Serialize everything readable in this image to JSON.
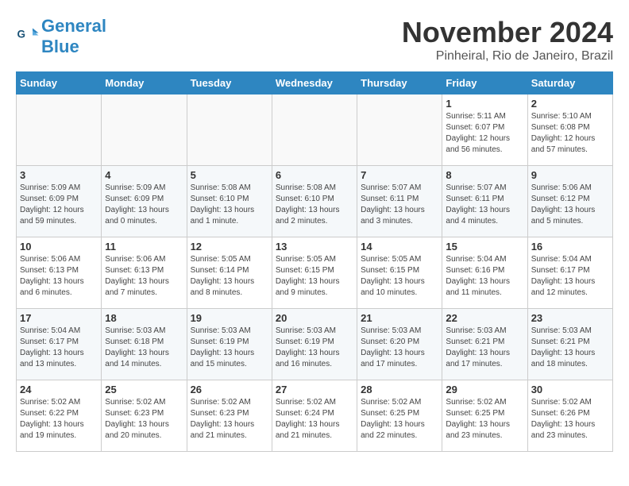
{
  "logo": {
    "line1": "General",
    "line2": "Blue"
  },
  "title": "November 2024",
  "location": "Pinheiral, Rio de Janeiro, Brazil",
  "headers": [
    "Sunday",
    "Monday",
    "Tuesday",
    "Wednesday",
    "Thursday",
    "Friday",
    "Saturday"
  ],
  "weeks": [
    [
      {
        "day": "",
        "info": ""
      },
      {
        "day": "",
        "info": ""
      },
      {
        "day": "",
        "info": ""
      },
      {
        "day": "",
        "info": ""
      },
      {
        "day": "",
        "info": ""
      },
      {
        "day": "1",
        "info": "Sunrise: 5:11 AM\nSunset: 6:07 PM\nDaylight: 12 hours\nand 56 minutes."
      },
      {
        "day": "2",
        "info": "Sunrise: 5:10 AM\nSunset: 6:08 PM\nDaylight: 12 hours\nand 57 minutes."
      }
    ],
    [
      {
        "day": "3",
        "info": "Sunrise: 5:09 AM\nSunset: 6:09 PM\nDaylight: 12 hours\nand 59 minutes."
      },
      {
        "day": "4",
        "info": "Sunrise: 5:09 AM\nSunset: 6:09 PM\nDaylight: 13 hours\nand 0 minutes."
      },
      {
        "day": "5",
        "info": "Sunrise: 5:08 AM\nSunset: 6:10 PM\nDaylight: 13 hours\nand 1 minute."
      },
      {
        "day": "6",
        "info": "Sunrise: 5:08 AM\nSunset: 6:10 PM\nDaylight: 13 hours\nand 2 minutes."
      },
      {
        "day": "7",
        "info": "Sunrise: 5:07 AM\nSunset: 6:11 PM\nDaylight: 13 hours\nand 3 minutes."
      },
      {
        "day": "8",
        "info": "Sunrise: 5:07 AM\nSunset: 6:11 PM\nDaylight: 13 hours\nand 4 minutes."
      },
      {
        "day": "9",
        "info": "Sunrise: 5:06 AM\nSunset: 6:12 PM\nDaylight: 13 hours\nand 5 minutes."
      }
    ],
    [
      {
        "day": "10",
        "info": "Sunrise: 5:06 AM\nSunset: 6:13 PM\nDaylight: 13 hours\nand 6 minutes."
      },
      {
        "day": "11",
        "info": "Sunrise: 5:06 AM\nSunset: 6:13 PM\nDaylight: 13 hours\nand 7 minutes."
      },
      {
        "day": "12",
        "info": "Sunrise: 5:05 AM\nSunset: 6:14 PM\nDaylight: 13 hours\nand 8 minutes."
      },
      {
        "day": "13",
        "info": "Sunrise: 5:05 AM\nSunset: 6:15 PM\nDaylight: 13 hours\nand 9 minutes."
      },
      {
        "day": "14",
        "info": "Sunrise: 5:05 AM\nSunset: 6:15 PM\nDaylight: 13 hours\nand 10 minutes."
      },
      {
        "day": "15",
        "info": "Sunrise: 5:04 AM\nSunset: 6:16 PM\nDaylight: 13 hours\nand 11 minutes."
      },
      {
        "day": "16",
        "info": "Sunrise: 5:04 AM\nSunset: 6:17 PM\nDaylight: 13 hours\nand 12 minutes."
      }
    ],
    [
      {
        "day": "17",
        "info": "Sunrise: 5:04 AM\nSunset: 6:17 PM\nDaylight: 13 hours\nand 13 minutes."
      },
      {
        "day": "18",
        "info": "Sunrise: 5:03 AM\nSunset: 6:18 PM\nDaylight: 13 hours\nand 14 minutes."
      },
      {
        "day": "19",
        "info": "Sunrise: 5:03 AM\nSunset: 6:19 PM\nDaylight: 13 hours\nand 15 minutes."
      },
      {
        "day": "20",
        "info": "Sunrise: 5:03 AM\nSunset: 6:19 PM\nDaylight: 13 hours\nand 16 minutes."
      },
      {
        "day": "21",
        "info": "Sunrise: 5:03 AM\nSunset: 6:20 PM\nDaylight: 13 hours\nand 17 minutes."
      },
      {
        "day": "22",
        "info": "Sunrise: 5:03 AM\nSunset: 6:21 PM\nDaylight: 13 hours\nand 17 minutes."
      },
      {
        "day": "23",
        "info": "Sunrise: 5:03 AM\nSunset: 6:21 PM\nDaylight: 13 hours\nand 18 minutes."
      }
    ],
    [
      {
        "day": "24",
        "info": "Sunrise: 5:02 AM\nSunset: 6:22 PM\nDaylight: 13 hours\nand 19 minutes."
      },
      {
        "day": "25",
        "info": "Sunrise: 5:02 AM\nSunset: 6:23 PM\nDaylight: 13 hours\nand 20 minutes."
      },
      {
        "day": "26",
        "info": "Sunrise: 5:02 AM\nSunset: 6:23 PM\nDaylight: 13 hours\nand 21 minutes."
      },
      {
        "day": "27",
        "info": "Sunrise: 5:02 AM\nSunset: 6:24 PM\nDaylight: 13 hours\nand 21 minutes."
      },
      {
        "day": "28",
        "info": "Sunrise: 5:02 AM\nSunset: 6:25 PM\nDaylight: 13 hours\nand 22 minutes."
      },
      {
        "day": "29",
        "info": "Sunrise: 5:02 AM\nSunset: 6:25 PM\nDaylight: 13 hours\nand 23 minutes."
      },
      {
        "day": "30",
        "info": "Sunrise: 5:02 AM\nSunset: 6:26 PM\nDaylight: 13 hours\nand 23 minutes."
      }
    ]
  ]
}
